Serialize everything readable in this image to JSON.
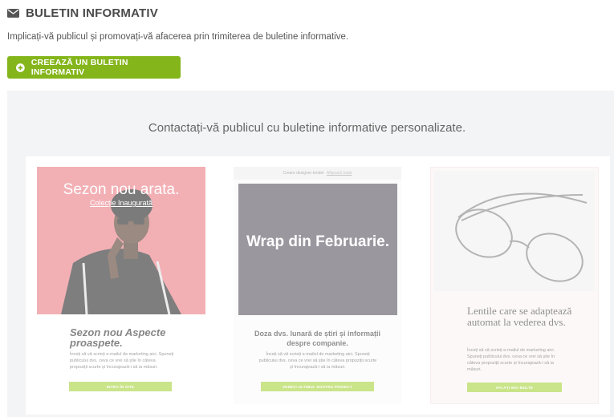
{
  "header": {
    "icon": "envelope-icon",
    "title": "BULETIN INFORMATIV",
    "description": "Implicați-vă publicul și promovați-vă afacerea prin trimiterea de buletine informative."
  },
  "create_button": {
    "icon": "plus-circle-icon",
    "label": "CREEAZĂ UN BULETIN INFORMATIV",
    "color": "#84b51b"
  },
  "gallery": {
    "heading": "Contactați-vă publicul cu buletine informative personalizate.",
    "templates": [
      {
        "hero_title": "Sezon nou arata.",
        "hero_subtitle": "Colecție Inaugurată",
        "heading": "Sezon nou Aspecte proaspete.",
        "body": "Înceți să vă scrieți e-mailul de marketing aici. Spuneți publicului dvs. ceva ce vrei să știe în câteva propoziții scurte și încurajează-i să ia măsuri.",
        "cta": "INTRA ÎN SITE",
        "accent": "#e9707a"
      },
      {
        "top_bar": "Creare designer tender",
        "top_bar_link": "Afișează toate",
        "hero_title": "Wrap din Februarie.",
        "heading": "Doza dvs. lunară de știri și informații despre companie.",
        "body": "Înceți să vă scrieți e-mailul de marketing aici. Spuneți publicului dvs. ceva ce vrei să știe în câteva propoziții scurte și încurajează-i să ia măsuri.",
        "cta": "VEDEȚI ULTIMUL NOSTRU PROIECT",
        "accent": "#4a4352"
      },
      {
        "heading": "Lentile care se adaptează automat la vederea dvs.",
        "body": "Înceți să vă scrieți e-mailul de marketing aici. Spuneți publicului dvs. ceva ce vrei să știe în câteva propoziții scurte și încurajează-i să ia măsuri.",
        "cta": "AFLAȚI MAI MULTE",
        "accent": "#9fcf2c"
      }
    ]
  }
}
